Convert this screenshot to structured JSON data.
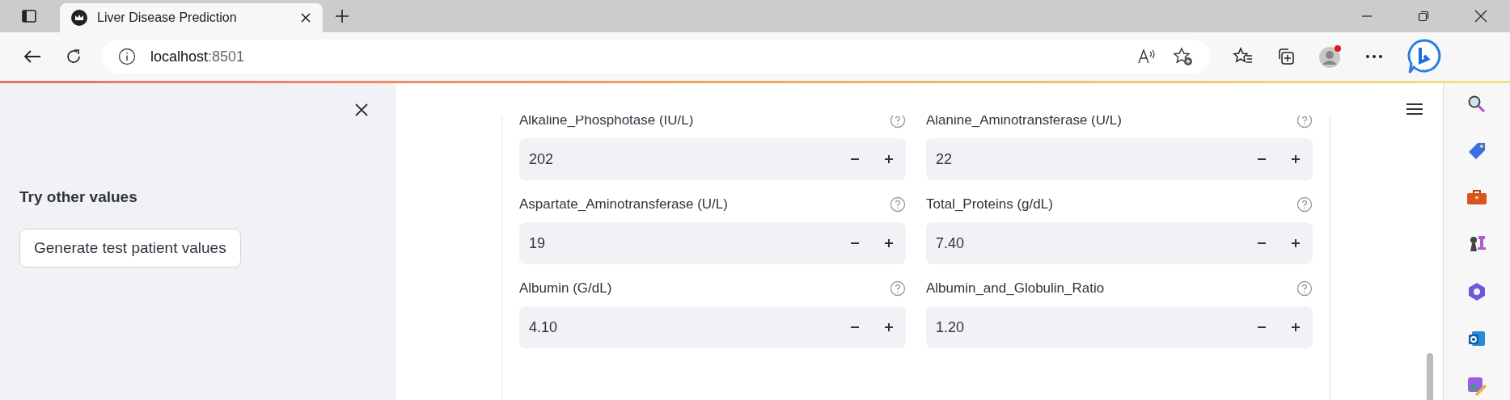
{
  "browser": {
    "tab_title": "Liver Disease Prediction",
    "url_host": "localhost",
    "url_port": ":8501"
  },
  "sidebar": {
    "heading": "Try other values",
    "button": "Generate test patient values"
  },
  "fields": [
    {
      "label": "Alkaline_Phosphotase (IU/L)",
      "value": "202"
    },
    {
      "label": "Alanine_Aminotransferase (U/L)",
      "value": "22"
    },
    {
      "label": "Aspartate_Aminotransferase (U/L)",
      "value": "19"
    },
    {
      "label": "Total_Proteins (g/dL)",
      "value": "7.40"
    },
    {
      "label": "Albumin (G/dL)",
      "value": "4.10"
    },
    {
      "label": "Albumin_and_Globulin_Ratio",
      "value": "1.20"
    }
  ]
}
